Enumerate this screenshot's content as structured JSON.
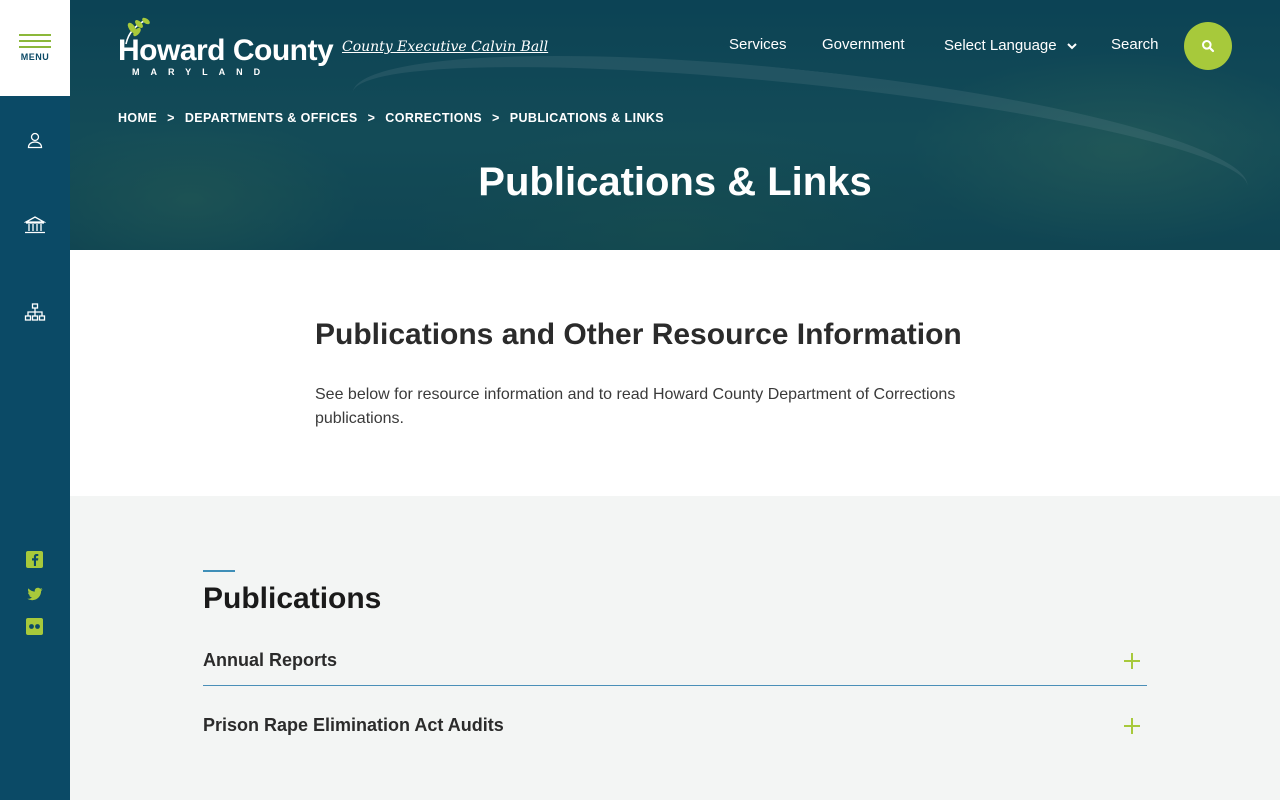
{
  "sidebar": {
    "menu_label": "MENU",
    "icons": [
      "user-icon",
      "government-building-icon",
      "org-chart-icon"
    ],
    "social": [
      "facebook-icon",
      "twitter-icon",
      "flickr-icon"
    ]
  },
  "header": {
    "logo_main": "Howard County",
    "logo_sub": "MARYLAND",
    "exec_link": "County Executive Calvin Ball",
    "nav": {
      "services": "Services",
      "government": "Government",
      "language": "Select Language",
      "search": "Search"
    }
  },
  "breadcrumb": {
    "home": "HOME",
    "departments": "DEPARTMENTS & OFFICES",
    "corrections": "CORRECTIONS",
    "current": "PUBLICATIONS & LINKS",
    "separator": ">"
  },
  "page_title": "Publications & Links",
  "intro": {
    "title": "Publications and Other Resource Information",
    "text": "See below for resource information and to read Howard County Department of Corrections publications."
  },
  "publications": {
    "title": "Publications",
    "items": [
      {
        "label": "Annual Reports"
      },
      {
        "label": "Prison Rape Elimination Act Audits"
      }
    ]
  },
  "colors": {
    "rail": "#0b4a66",
    "accent_green": "#a7c93b",
    "accent_blue": "#3f8fb8",
    "section_bg": "#f3f5f4"
  }
}
